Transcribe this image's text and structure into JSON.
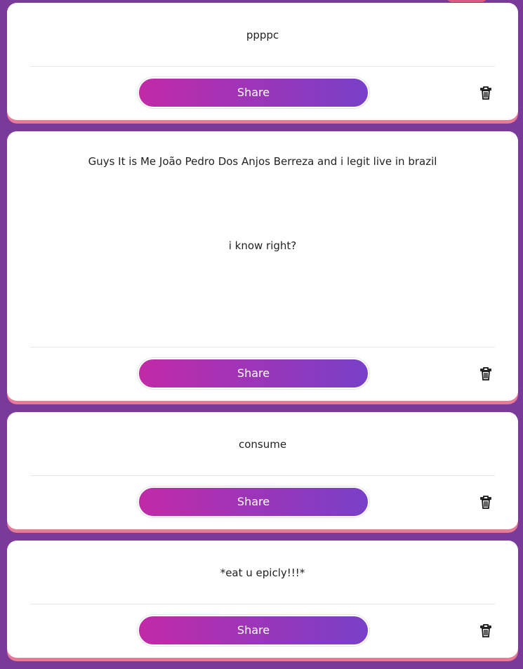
{
  "posts": [
    {
      "text_lines": [
        "ppppc"
      ],
      "share_label": "Share",
      "delete_icon": "trash-icon"
    },
    {
      "text_lines": [
        "Guys It is Me João Pedro Dos Anjos Berreza and i legit live in brazil",
        "i know right?"
      ],
      "share_label": "Share",
      "delete_icon": "trash-icon"
    },
    {
      "text_lines": [
        "consume"
      ],
      "share_label": "Share",
      "delete_icon": "trash-icon"
    },
    {
      "text_lines": [
        "*eat u epicly!!!*"
      ],
      "share_label": "Share",
      "delete_icon": "trash-icon"
    }
  ],
  "colors": {
    "background": "#7a3a9a",
    "card": "#ffffff",
    "card_edge": "#e77a97",
    "share_gradient_start": "#c12aa8",
    "share_gradient_end": "#7840c8"
  }
}
